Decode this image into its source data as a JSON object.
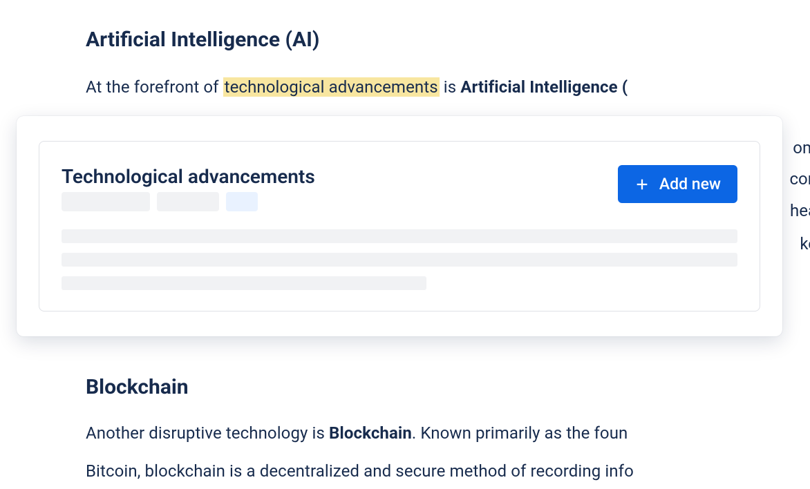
{
  "section1": {
    "heading": "Artificial Intelligence (AI)",
    "para_pre": "At the forefront of ",
    "para_highlight": "technological advancements",
    "para_mid": " is ",
    "para_bold": "Artificial Intelligence ("
  },
  "backgroundFragments": {
    "line1": "om",
    "line2": "con",
    "line3": "hea",
    "line4": "ke "
  },
  "popup": {
    "title": "Technological advancements",
    "addButton": "Add new"
  },
  "section2": {
    "heading": "Blockchain",
    "para_pre": "Another disruptive technology is ",
    "para_bold": "Blockchain",
    "para_post": ". Known primarily as the foun",
    "para_line2": "Bitcoin, blockchain is a decentralized and secure method of recording info"
  }
}
